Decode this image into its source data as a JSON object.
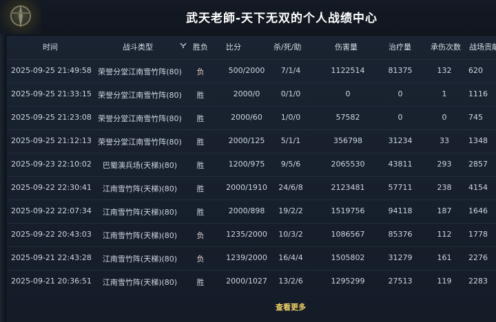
{
  "title": "武天老師-天下无双的个人战绩中心",
  "headers": {
    "time": "时间",
    "type": "战斗类型",
    "result": "胜负",
    "score": "比分",
    "kda": "杀/死/助",
    "damage": "伤害量",
    "heal": "治疗量",
    "tank": "承伤次数",
    "points": "战场贡献"
  },
  "rows": [
    {
      "time": "2025-09-25 21:49:58",
      "type": "荣誉分堂江南雪竹阵(80)",
      "result": "负",
      "score": "500/2000",
      "kda": "7/1/4",
      "damage": "1122514",
      "heal": "81375",
      "tank": "132",
      "points": "620"
    },
    {
      "time": "2025-09-25 21:33:15",
      "type": "荣誉分堂江南雪竹阵(80)",
      "result": "胜",
      "score": "2000/0",
      "kda": "0/1/0",
      "damage": "0",
      "heal": "0",
      "tank": "1",
      "points": "1116"
    },
    {
      "time": "2025-09-25 21:23:08",
      "type": "荣誉分堂江南雪竹阵(80)",
      "result": "胜",
      "score": "2000/60",
      "kda": "1/0/0",
      "damage": "57582",
      "heal": "0",
      "tank": "0",
      "points": "745"
    },
    {
      "time": "2025-09-25 21:12:13",
      "type": "荣誉分堂江南雪竹阵(80)",
      "result": "胜",
      "score": "2000/125",
      "kda": "5/1/1",
      "damage": "356798",
      "heal": "31234",
      "tank": "33",
      "points": "1348"
    },
    {
      "time": "2025-09-23 22:10:02",
      "type": "巴蜀演兵场(天梯)(80)",
      "result": "胜",
      "score": "1200/975",
      "kda": "9/5/6",
      "damage": "2065530",
      "heal": "43811",
      "tank": "293",
      "points": "2857"
    },
    {
      "time": "2025-09-22 22:30:41",
      "type": "江南雪竹阵(天梯)(80)",
      "result": "胜",
      "score": "2000/1910",
      "kda": "24/6/8",
      "damage": "2123481",
      "heal": "57711",
      "tank": "238",
      "points": "4154"
    },
    {
      "time": "2025-09-22 22:07:34",
      "type": "江南雪竹阵(天梯)(80)",
      "result": "胜",
      "score": "2000/898",
      "kda": "19/2/2",
      "damage": "1519756",
      "heal": "94118",
      "tank": "187",
      "points": "1646"
    },
    {
      "time": "2025-09-22 20:43:03",
      "type": "江南雪竹阵(天梯)(80)",
      "result": "负",
      "score": "1235/2000",
      "kda": "10/3/2",
      "damage": "1086567",
      "heal": "85376",
      "tank": "112",
      "points": "1778"
    },
    {
      "time": "2025-09-21 22:43:28",
      "type": "江南雪竹阵(天梯)(80)",
      "result": "负",
      "score": "1239/2000",
      "kda": "16/4/4",
      "damage": "1505802",
      "heal": "31279",
      "tank": "161",
      "points": "2276"
    },
    {
      "time": "2025-09-21 20:36:51",
      "type": "江南雪竹阵(天梯)(80)",
      "result": "胜",
      "score": "2000/1027",
      "kda": "13/2/6",
      "damage": "1295299",
      "heal": "27513",
      "tank": "119",
      "points": "2283"
    }
  ],
  "more_label": "查看更多",
  "colors": {
    "accent": "#f1d267",
    "panel": "#1a2331",
    "background": "#0f141d"
  }
}
